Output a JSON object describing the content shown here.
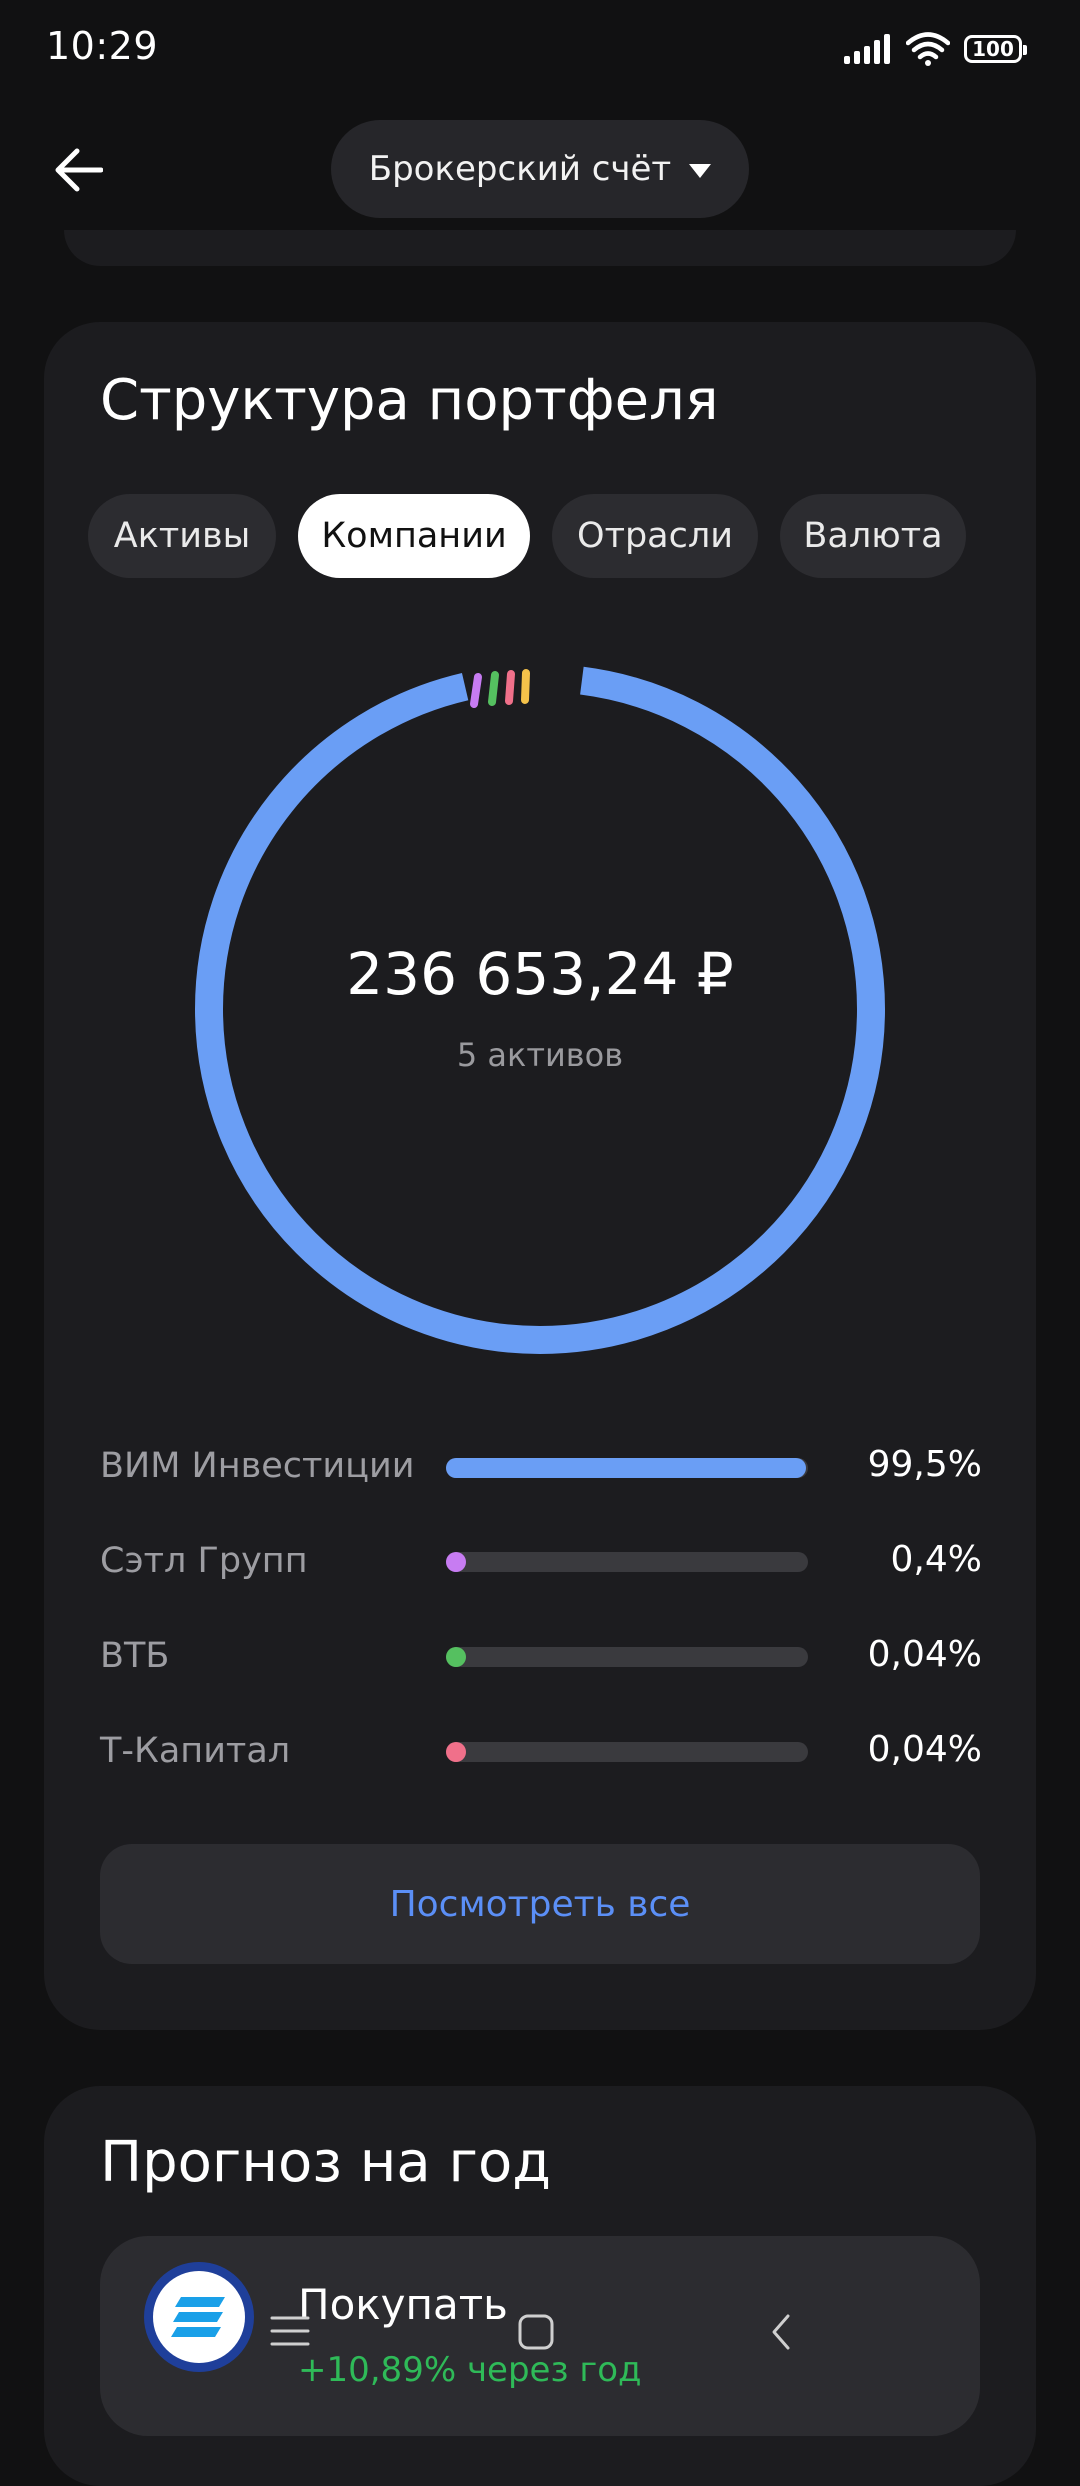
{
  "status_bar": {
    "time": "10:29",
    "battery": "100"
  },
  "header": {
    "account_label": "Брокерский счёт"
  },
  "structure": {
    "title": "Структура портфеля",
    "tabs": [
      {
        "label": "Активы",
        "active": false
      },
      {
        "label": "Компании",
        "active": true
      },
      {
        "label": "Отрасли",
        "active": false
      },
      {
        "label": "Валюта",
        "active": false
      }
    ],
    "total_value": "236 653,24 ₽",
    "total_sub": "5 активов",
    "rows": [
      {
        "name": "ВИМ Инвестиции",
        "percent_label": "99,5%",
        "share": 99.5,
        "color": "#6a9ef5"
      },
      {
        "name": "Сэтл Групп",
        "percent_label": "0,4%",
        "share": 0.4,
        "color": "#c77cf2"
      },
      {
        "name": "ВТБ",
        "percent_label": "0,04%",
        "share": 0.04,
        "color": "#55c060"
      },
      {
        "name": "Т-Капитал",
        "percent_label": "0,04%",
        "share": 0.04,
        "color": "#f0708a"
      }
    ],
    "donut_colors": {
      "main": "#6a9ef5",
      "small": [
        "#c77cf2",
        "#55c060",
        "#f0708a",
        "#f5c24a"
      ]
    },
    "see_all_label": "Посмотреть все"
  },
  "forecast": {
    "title": "Прогноз на год",
    "item_title": "Покупать",
    "item_sub": "+10,89% через год"
  },
  "icons": {
    "back": "arrow-left-icon",
    "dropdown": "triangle-down-icon",
    "nav_menu": "menu-icon",
    "nav_home": "square-icon",
    "nav_back": "chevron-left-icon"
  }
}
